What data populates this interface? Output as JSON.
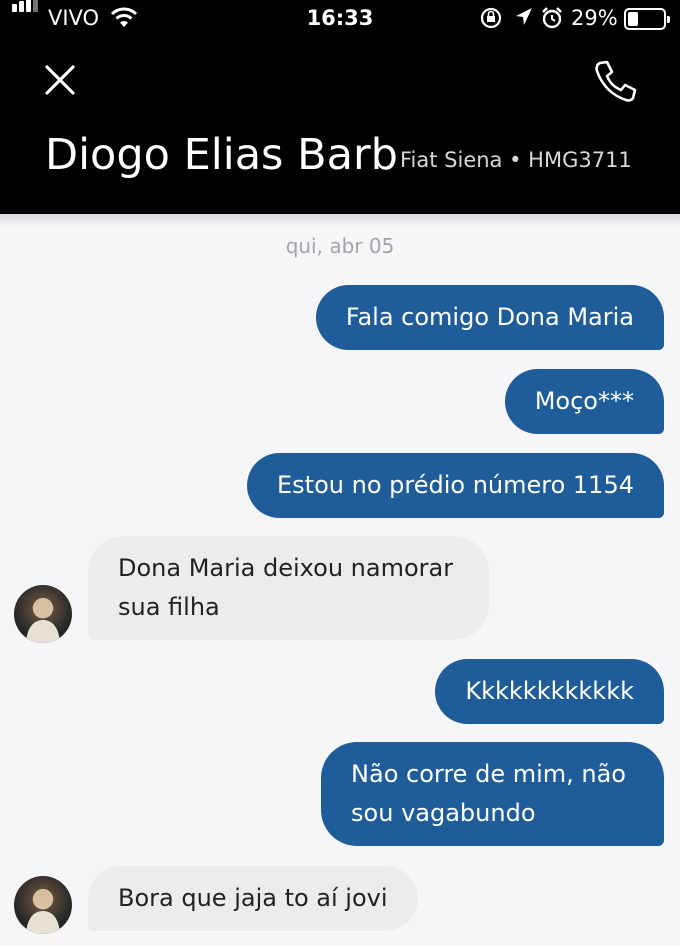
{
  "status_bar": {
    "carrier": "VIVO",
    "time": "16:33",
    "battery": "29%",
    "battery_level": 0.29,
    "icons": [
      "signal-icon",
      "wifi-icon",
      "rotation-lock-icon",
      "location-icon",
      "alarm-icon",
      "battery-icon"
    ]
  },
  "header": {
    "contact_name": "Diogo Elias Barbosa",
    "vehicle": "Fiat Siena • HMG3711",
    "icons": [
      "close-icon",
      "phone-icon"
    ]
  },
  "conversation": {
    "date": "qui, abr 05",
    "messages": [
      {
        "dir": "out",
        "text": "Fala comigo Dona Maria"
      },
      {
        "dir": "out",
        "text": "Moço***"
      },
      {
        "dir": "out",
        "text": "Estou no prédio número 1154"
      },
      {
        "dir": "in",
        "lines": [
          "Dona Maria deixou namorar",
          "sua filha"
        ]
      },
      {
        "dir": "out",
        "text": "Kkkkkkkkkkkk"
      },
      {
        "dir": "out",
        "lines": [
          "Não corre de mim, não",
          "sou vagabundo"
        ]
      },
      {
        "dir": "in",
        "text": "Bora que jaja to aí jovi"
      }
    ]
  },
  "colors": {
    "header_bg": "#000000",
    "outgoing_bubble": "#1f5c9a",
    "incoming_bubble": "#ececec",
    "background": "#f6f6f8"
  }
}
